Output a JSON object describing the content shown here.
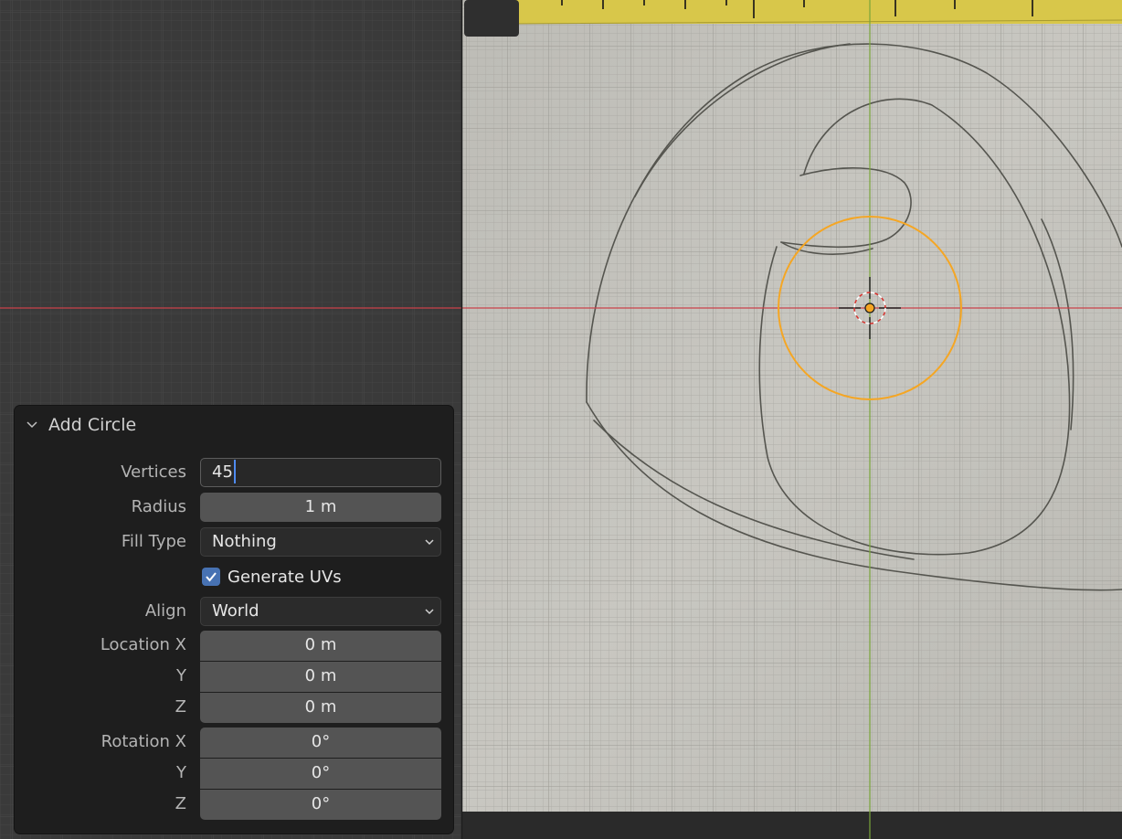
{
  "viewport": {
    "grid_color": "#444444",
    "background_color": "#3a3a3a",
    "x_axis_color": "#c9424a",
    "y_axis_color": "#79a53a",
    "selection_color": "#f5a623"
  },
  "panel": {
    "title": "Add Circle",
    "vertices_label": "Vertices",
    "vertices_value": "45",
    "radius_label": "Radius",
    "radius_value": "1 m",
    "fill_type_label": "Fill Type",
    "fill_type_value": "Nothing",
    "generate_uvs_label": "Generate UVs",
    "generate_uvs_checked": true,
    "align_label": "Align",
    "align_value": "World",
    "location_x_label": "Location X",
    "location_y_label": "Y",
    "location_z_label": "Z",
    "location_x": "0 m",
    "location_y": "0 m",
    "location_z": "0 m",
    "rotation_x_label": "Rotation X",
    "rotation_y_label": "Y",
    "rotation_z_label": "Z",
    "rotation_x": "0°",
    "rotation_y": "0°",
    "rotation_z": "0°"
  }
}
